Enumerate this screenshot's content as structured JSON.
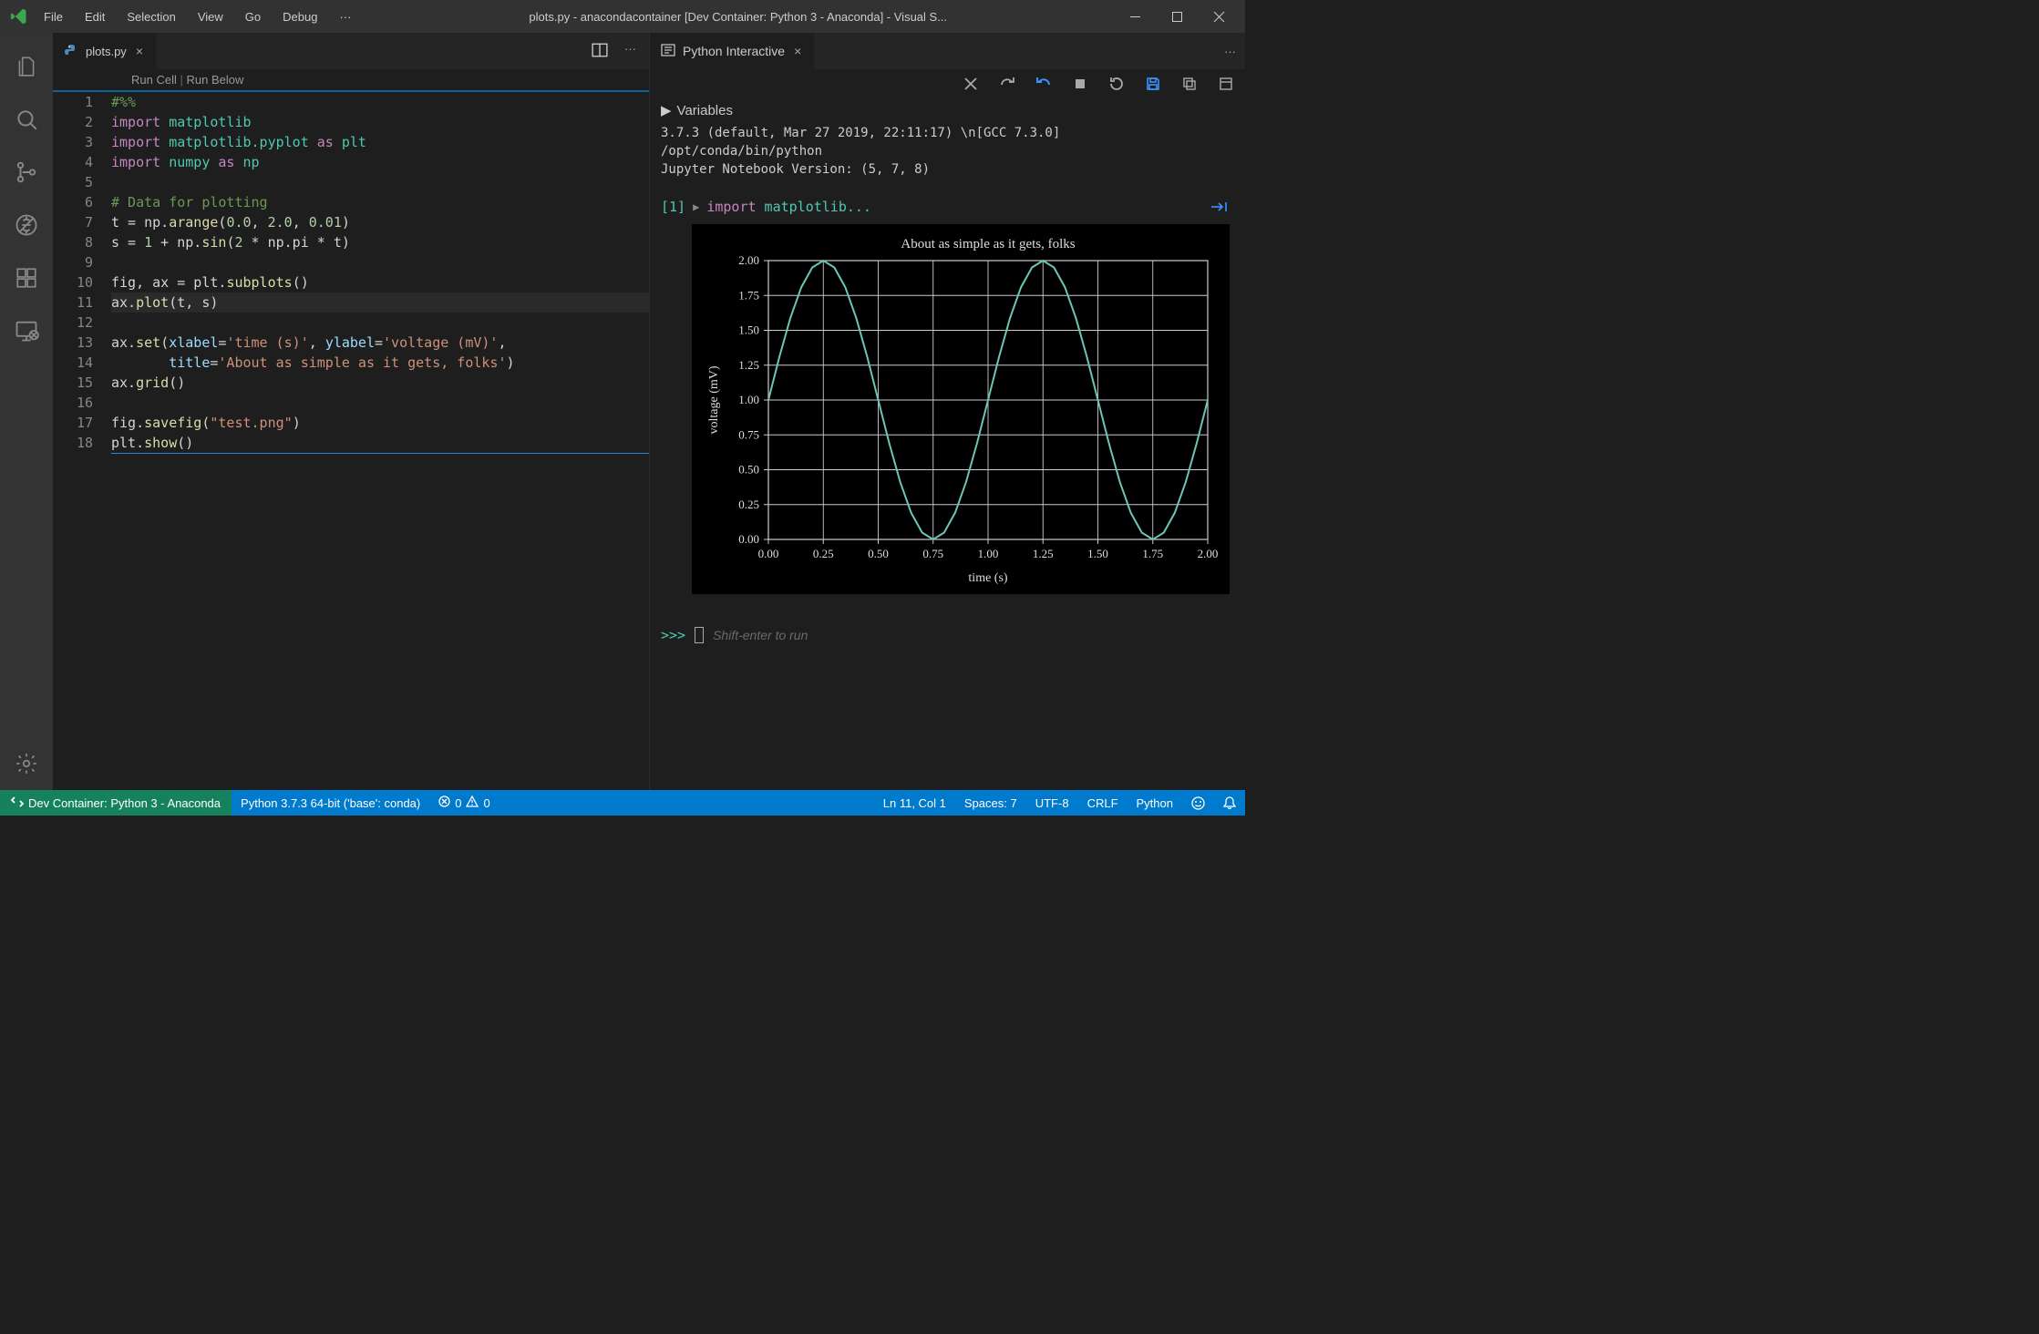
{
  "window": {
    "title": "plots.py - anacondacontainer [Dev Container: Python 3 - Anaconda] - Visual S..."
  },
  "menu": [
    "File",
    "Edit",
    "Selection",
    "View",
    "Go",
    "Debug"
  ],
  "tabs": {
    "editor": {
      "filename": "plots.py"
    },
    "interactive": {
      "title": "Python Interactive"
    }
  },
  "codelens": {
    "run_cell": "Run Cell",
    "run_below": "Run Below"
  },
  "gutter": [
    "1",
    "2",
    "3",
    "4",
    "5",
    "6",
    "7",
    "8",
    "9",
    "10",
    "11",
    "12",
    "13",
    "14",
    "15",
    "16",
    "17",
    "18"
  ],
  "code": {
    "l1": "#%%",
    "l2": {
      "kw": "import",
      "mod": " matplotlib"
    },
    "l3": {
      "kw1": "import",
      "mod": " matplotlib.pyplot ",
      "kw2": "as",
      "alias": " plt"
    },
    "l4": {
      "kw1": "import",
      "mod": " numpy ",
      "kw2": "as",
      "alias": " np"
    },
    "l6": "# Data for plotting",
    "l7": {
      "a": "t = np.",
      "fn": "arange",
      "b": "(",
      "n1": "0.0",
      "c": ", ",
      "n2": "2.0",
      "d": ", ",
      "n3": "0.01",
      "e": ")"
    },
    "l8": {
      "a": "s = ",
      "n1": "1",
      "b": " + np.",
      "fn": "sin",
      "c": "(",
      "n2": "2",
      "d": " * np.pi * t)"
    },
    "l10": {
      "a": "fig, ax = plt.",
      "fn": "subplots",
      "b": "()"
    },
    "l11": {
      "a": "ax.",
      "fn": "plot",
      "b": "(t, s)"
    },
    "l13": {
      "a": "ax.",
      "fn": "set",
      "b": "(",
      "p1": "xlabel",
      "c": "=",
      "s1": "'time (s)'",
      "d": ", ",
      "p2": "ylabel",
      "e": "=",
      "s2": "'voltage (mV)'",
      "f": ","
    },
    "l14": {
      "a": "       ",
      "p1": "title",
      "b": "=",
      "s1": "'About as simple as it gets, folks'",
      "c": ")"
    },
    "l15": {
      "a": "ax.",
      "fn": "grid",
      "b": "()"
    },
    "l17": {
      "a": "fig.",
      "fn": "savefig",
      "b": "(",
      "s1": "\"test.png\"",
      "c": ")"
    },
    "l18": {
      "a": "plt.",
      "fn": "show",
      "b": "()"
    }
  },
  "interactive": {
    "variables_label": "Variables",
    "console_lines": "3.7.3 (default, Mar 27 2019, 22:11:17) \\n[GCC 7.3.0]\n/opt/conda/bin/python\nJupyter Notebook Version: (5, 7, 8)",
    "cell_index": "[1]",
    "cell_code_kw": "import",
    "cell_code_rest": " matplotlib...",
    "input_prompt": ">>>",
    "input_placeholder": "Shift-enter to run"
  },
  "statusbar": {
    "remote": "Dev Container: Python 3 - Anaconda",
    "python": "Python 3.7.3 64-bit ('base': conda)",
    "errors": "0",
    "warnings": "0",
    "position": "Ln 11, Col 1",
    "spaces": "Spaces: 7",
    "encoding": "UTF-8",
    "eol": "CRLF",
    "language": "Python"
  },
  "chart_data": {
    "type": "line",
    "title": "About as simple as it gets, folks",
    "xlabel": "time (s)",
    "ylabel": "voltage (mV)",
    "xlim": [
      0,
      2
    ],
    "ylim": [
      0,
      2
    ],
    "xticks": [
      0.0,
      0.25,
      0.5,
      0.75,
      1.0,
      1.25,
      1.5,
      1.75,
      2.0
    ],
    "yticks": [
      0.0,
      0.25,
      0.5,
      0.75,
      1.0,
      1.25,
      1.5,
      1.75,
      2.0
    ],
    "x": [
      0.0,
      0.05,
      0.1,
      0.15,
      0.2,
      0.25,
      0.3,
      0.35,
      0.4,
      0.45,
      0.5,
      0.55,
      0.6,
      0.65,
      0.7,
      0.75,
      0.8,
      0.85,
      0.9,
      0.95,
      1.0,
      1.05,
      1.1,
      1.15,
      1.2,
      1.25,
      1.3,
      1.35,
      1.4,
      1.45,
      1.5,
      1.55,
      1.6,
      1.65,
      1.7,
      1.75,
      1.8,
      1.85,
      1.9,
      1.95,
      2.0
    ],
    "y": [
      1.0,
      1.309,
      1.5878,
      1.809,
      1.9511,
      2.0,
      1.9511,
      1.809,
      1.5878,
      1.309,
      1.0,
      0.691,
      0.4122,
      0.191,
      0.0489,
      0.0,
      0.0489,
      0.191,
      0.4122,
      0.691,
      1.0,
      1.309,
      1.5878,
      1.809,
      1.9511,
      2.0,
      1.9511,
      1.809,
      1.5878,
      1.309,
      1.0,
      0.691,
      0.4122,
      0.191,
      0.0489,
      0.0,
      0.0489,
      0.191,
      0.4122,
      0.691,
      1.0
    ],
    "grid": true,
    "line_color": "#6bc6b6"
  }
}
